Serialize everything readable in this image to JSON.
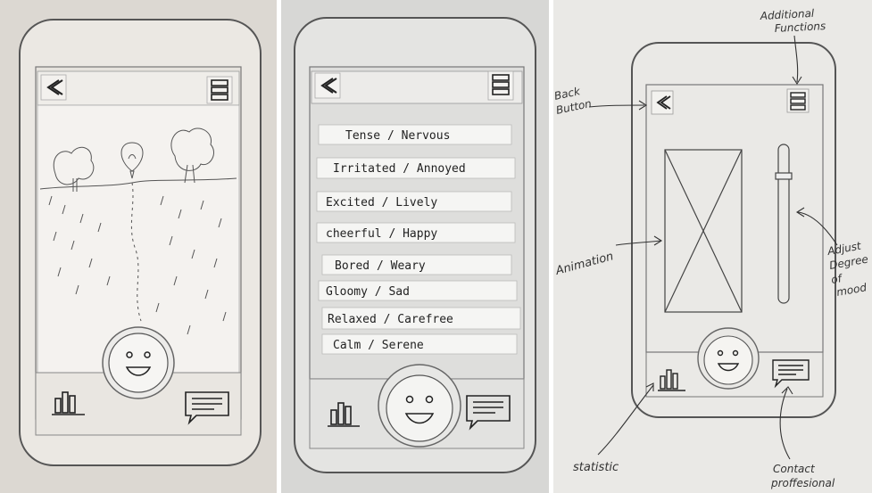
{
  "panel1": {
    "buttons": {
      "back": "back",
      "menu": "menu"
    }
  },
  "panel2": {
    "moods": [
      "Tense / Nervous",
      "Irritated / Annoyed",
      "Excited / Lively",
      "cheerful / Happy",
      "Bored / Weary",
      "Gloomy  / Sad",
      "Relaxed / Carefree",
      "Calm  / Serene"
    ]
  },
  "panel3": {
    "annotations": {
      "additional_functions_1": "Additional",
      "additional_functions_2": "Functions",
      "back_button_1": "Back",
      "back_button_2": "Button",
      "animation": "Animation",
      "adjust_1": "Adjust",
      "adjust_2": "Degree",
      "adjust_3": "of",
      "adjust_4": "mood",
      "statistic": "statistic",
      "contact_1": "Contact",
      "contact_2": "proffesional"
    }
  }
}
